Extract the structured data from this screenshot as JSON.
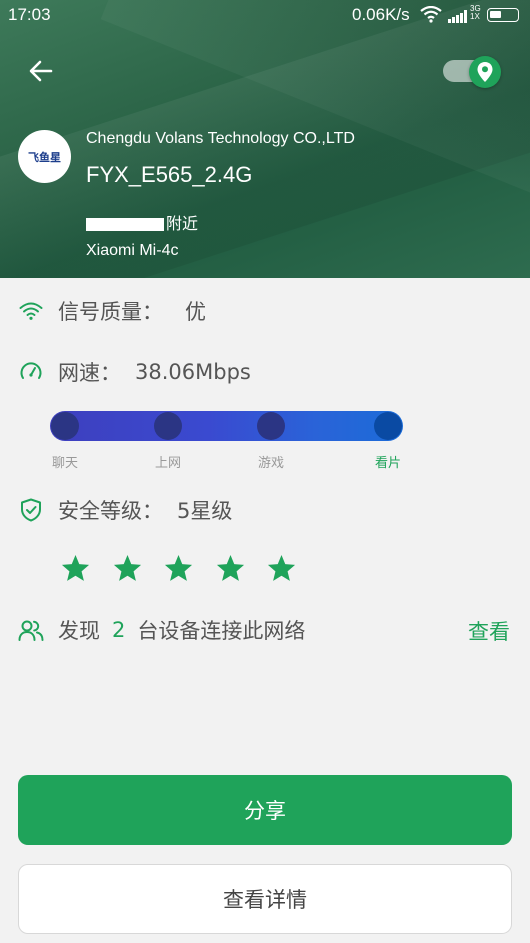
{
  "status_bar": {
    "time": "17:03",
    "net_speed": "0.06K/s",
    "net_type_top": "3G",
    "net_type_bottom": "1X"
  },
  "header": {
    "company": "Chengdu Volans Technology CO.,LTD",
    "ssid": "FYX_E565_2.4G",
    "location_suffix": "附近",
    "device": "Xiaomi Mi-4c",
    "logo_text": "飞鱼星"
  },
  "signal": {
    "label": "信号质量：",
    "value": "优"
  },
  "speed": {
    "label": "网速：",
    "value": "38.06Mbps",
    "levels": [
      "聊天",
      "上网",
      "游戏",
      "看片"
    ],
    "active_level": "看片"
  },
  "security": {
    "label": "安全等级：",
    "value": "5星级",
    "stars": 5
  },
  "devices": {
    "prefix": "发现",
    "count": "2",
    "suffix": "台设备连接此网络",
    "link": "查看"
  },
  "buttons": {
    "share": "分享",
    "details": "查看详情"
  },
  "colors": {
    "accent": "#1fa35a",
    "header_bg": "#2c6548",
    "speed_bar": "#3a4ad0"
  }
}
